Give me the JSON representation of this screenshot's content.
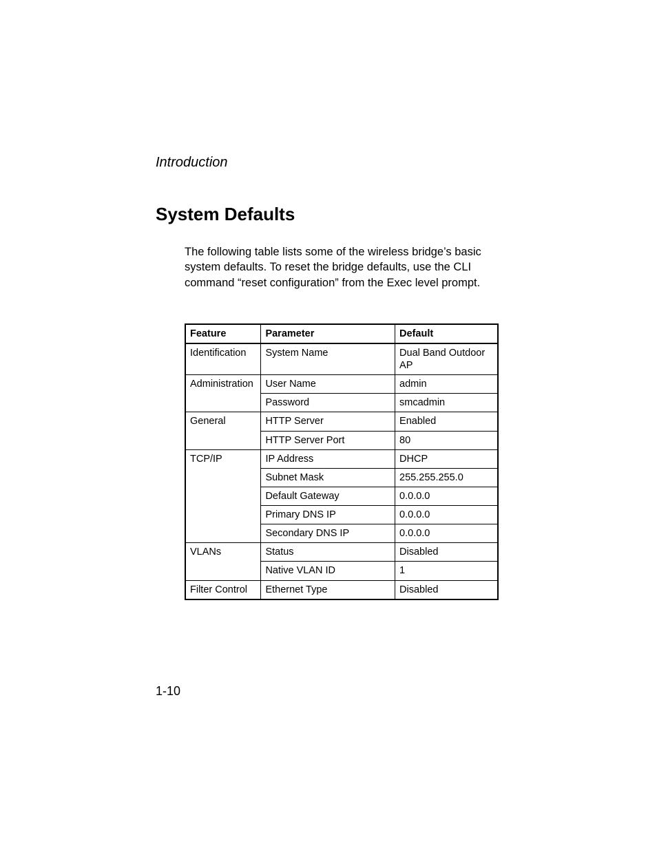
{
  "running_head": "Introduction",
  "section_title": "System Defaults",
  "intro_paragraph": "The following table lists some of the wireless bridge’s basic system defaults. To reset the bridge defaults, use the CLI command “reset configuration” from the Exec level prompt.",
  "table": {
    "headers": {
      "feature": "Feature",
      "parameter": "Parameter",
      "default": "Default"
    },
    "rows": [
      {
        "feature": "Identification",
        "parameter": "System Name",
        "default": "Dual Band Outdoor AP"
      },
      {
        "feature": "Administration",
        "parameter": "User Name",
        "default": "admin"
      },
      {
        "feature": "",
        "parameter": "Password",
        "default": "smcadmin"
      },
      {
        "feature": "General",
        "parameter": "HTTP Server",
        "default": "Enabled"
      },
      {
        "feature": "",
        "parameter": "HTTP Server Port",
        "default": "80"
      },
      {
        "feature": "TCP/IP",
        "parameter": "IP Address",
        "default": "DHCP"
      },
      {
        "feature": "",
        "parameter": "Subnet Mask",
        "default": "255.255.255.0"
      },
      {
        "feature": "",
        "parameter": "Default Gateway",
        "default": "0.0.0.0"
      },
      {
        "feature": "",
        "parameter": "Primary DNS IP",
        "default": "0.0.0.0"
      },
      {
        "feature": "",
        "parameter": "Secondary DNS IP",
        "default": "0.0.0.0"
      },
      {
        "feature": "VLANs",
        "parameter": "Status",
        "default": "Disabled"
      },
      {
        "feature": "",
        "parameter": "Native VLAN ID",
        "default": "1"
      },
      {
        "feature": "Filter Control",
        "parameter": "Ethernet Type",
        "default": "Disabled"
      }
    ]
  },
  "page_number": "1-10",
  "chart_data": {
    "type": "table",
    "title": "System Defaults",
    "columns": [
      "Feature",
      "Parameter",
      "Default"
    ],
    "data": [
      [
        "Identification",
        "System Name",
        "Dual Band Outdoor AP"
      ],
      [
        "Administration",
        "User Name",
        "admin"
      ],
      [
        "Administration",
        "Password",
        "smcadmin"
      ],
      [
        "General",
        "HTTP Server",
        "Enabled"
      ],
      [
        "General",
        "HTTP Server Port",
        "80"
      ],
      [
        "TCP/IP",
        "IP Address",
        "DHCP"
      ],
      [
        "TCP/IP",
        "Subnet Mask",
        "255.255.255.0"
      ],
      [
        "TCP/IP",
        "Default Gateway",
        "0.0.0.0"
      ],
      [
        "TCP/IP",
        "Primary DNS IP",
        "0.0.0.0"
      ],
      [
        "TCP/IP",
        "Secondary DNS IP",
        "0.0.0.0"
      ],
      [
        "VLANs",
        "Status",
        "Disabled"
      ],
      [
        "VLANs",
        "Native VLAN ID",
        "1"
      ],
      [
        "Filter Control",
        "Ethernet Type",
        "Disabled"
      ]
    ]
  }
}
